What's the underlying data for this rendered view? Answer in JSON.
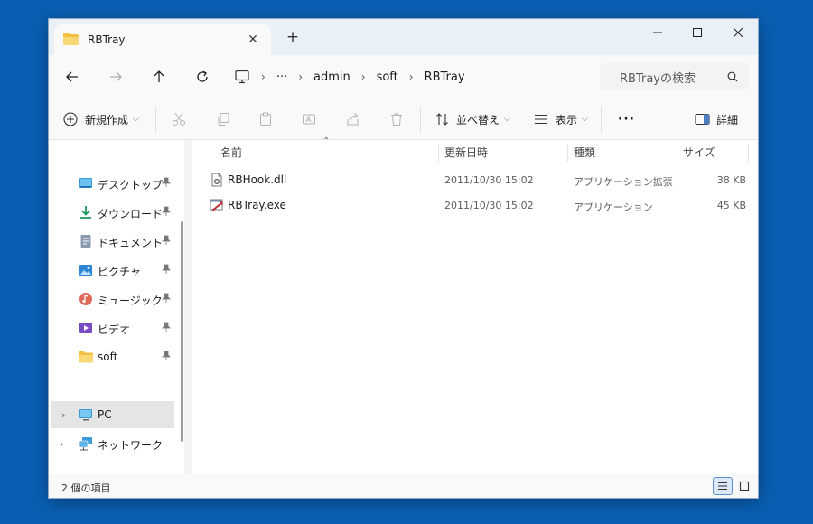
{
  "window": {
    "tab_title": "RBTray",
    "tab_close_glyph": "✕",
    "new_tab_glyph": "+"
  },
  "address": {
    "more": "···",
    "segments": [
      "admin",
      "soft",
      "RBTray"
    ],
    "search_placeholder": "RBTrayの検索"
  },
  "toolbar": {
    "new_label": "新規作成",
    "sort_label": "並べ替え",
    "view_label": "表示",
    "more_label": "···",
    "details_label": "詳細"
  },
  "sidebar": {
    "items": [
      {
        "label": "デスクトップ",
        "icon": "desktop-icon"
      },
      {
        "label": "ダウンロード",
        "icon": "download-icon"
      },
      {
        "label": "ドキュメント",
        "icon": "documents-icon"
      },
      {
        "label": "ピクチャ",
        "icon": "pictures-icon"
      },
      {
        "label": "ミュージック",
        "icon": "music-icon"
      },
      {
        "label": "ビデオ",
        "icon": "videos-icon"
      },
      {
        "label": "soft",
        "icon": "folder-icon"
      }
    ],
    "pc_label": "PC",
    "network_label": "ネットワーク"
  },
  "columns": {
    "name": "名前",
    "modified": "更新日時",
    "type": "種類",
    "size": "サイズ"
  },
  "files": [
    {
      "name": "RBHook.dll",
      "modified": "2011/10/30 15:02",
      "type": "アプリケーション拡張",
      "size": "38 KB",
      "icon": "dll-file-icon"
    },
    {
      "name": "RBTray.exe",
      "modified": "2011/10/30 15:02",
      "type": "アプリケーション",
      "size": "45 KB",
      "icon": "exe-file-icon"
    }
  ],
  "status": {
    "item_count": "2 個の項目"
  },
  "colors": {
    "desktop_bg": "#0a5fb4",
    "titlebar": "#eaf0f8",
    "accent": "#005fb8",
    "folder": "#f4c042"
  }
}
